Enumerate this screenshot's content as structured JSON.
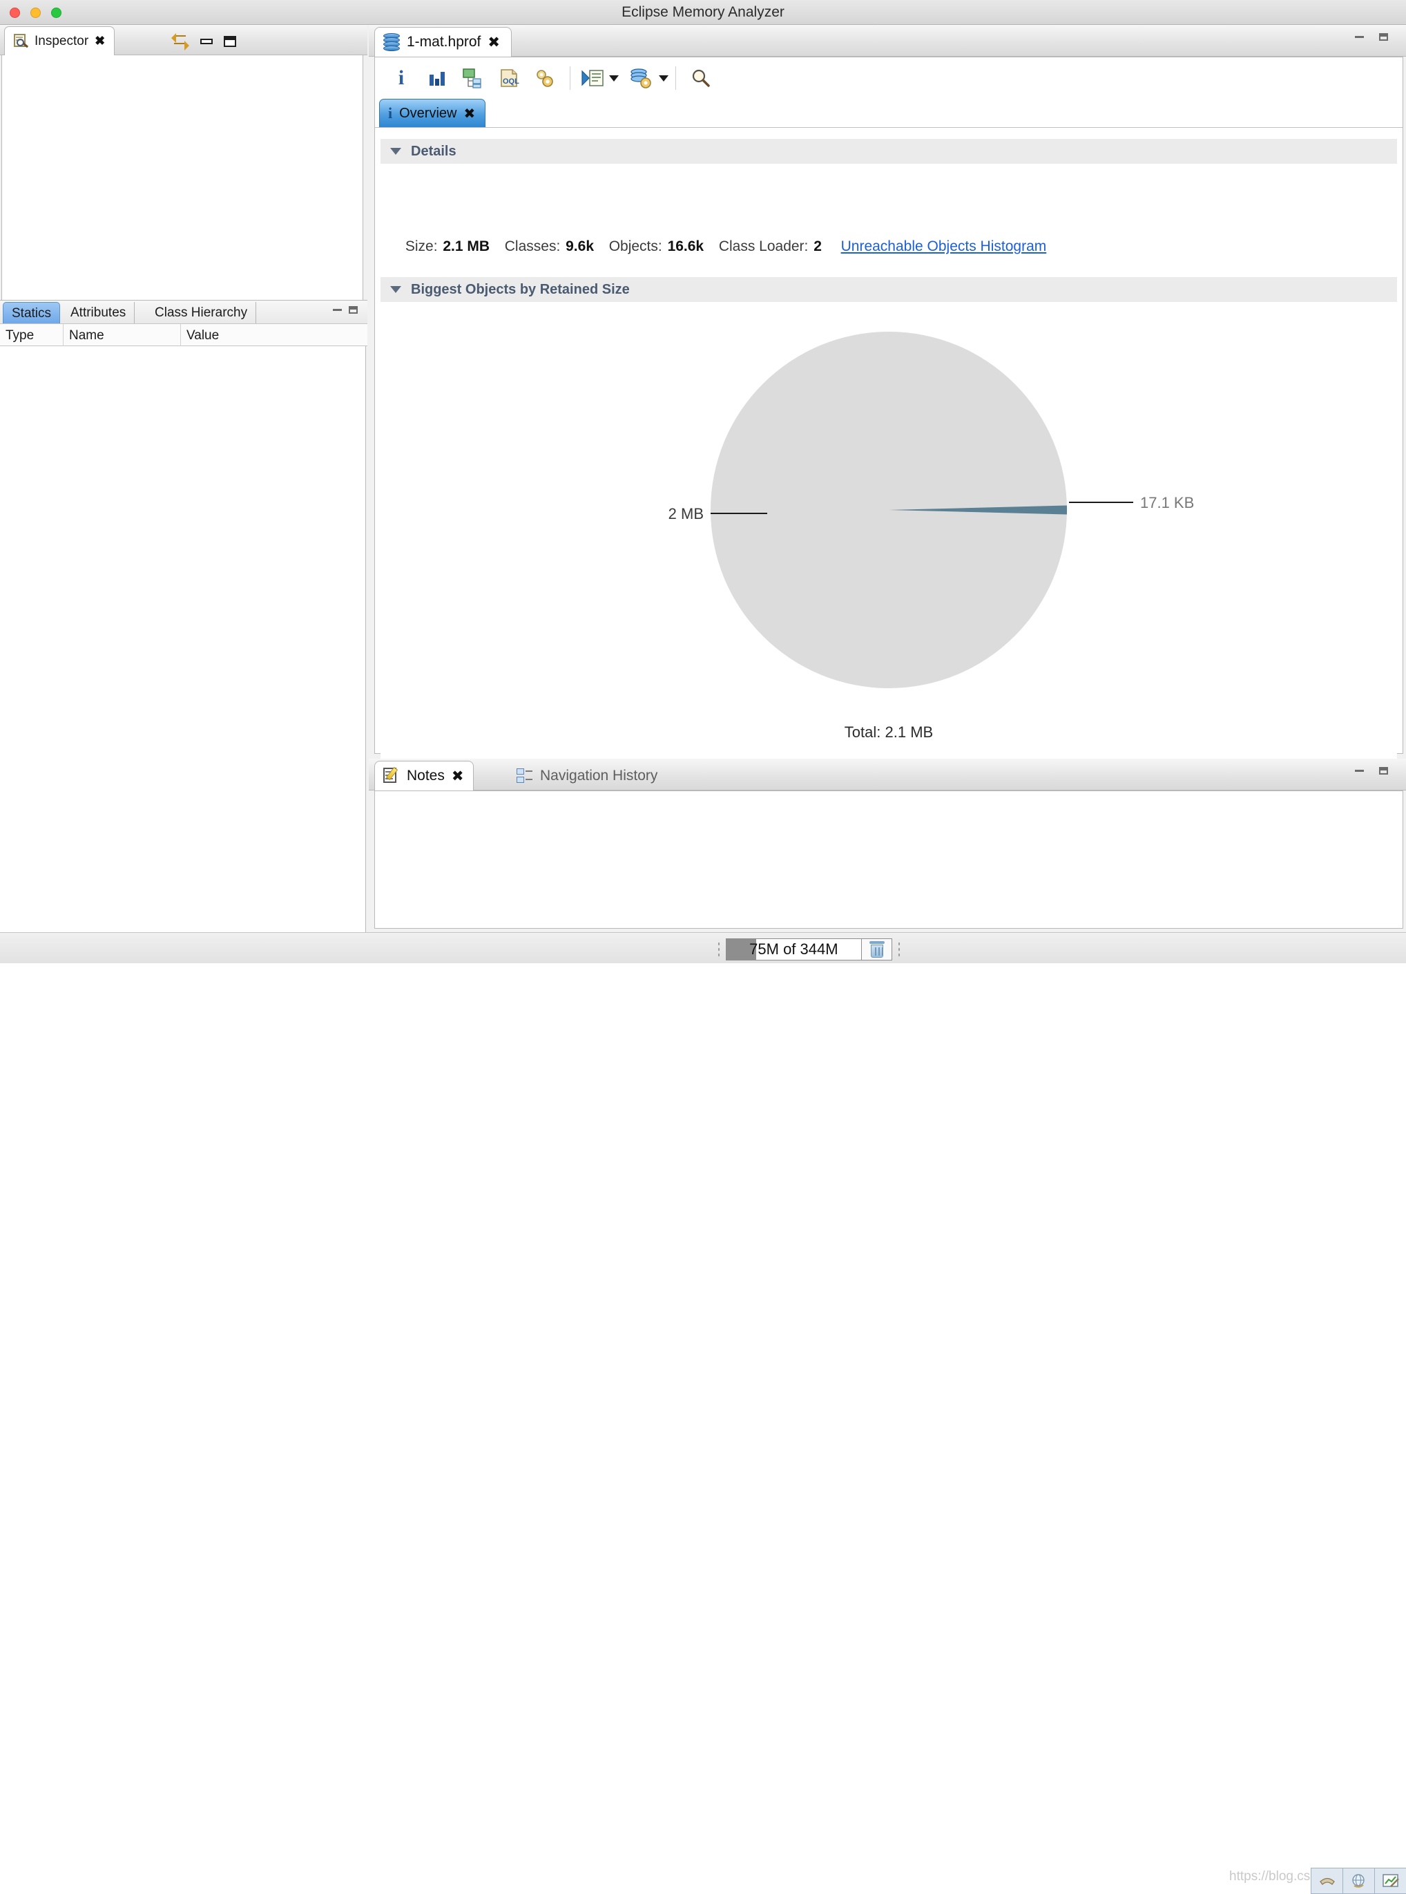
{
  "window": {
    "title": "Eclipse Memory Analyzer",
    "traffic_lights": [
      "close",
      "minimize",
      "maximize"
    ]
  },
  "inspector": {
    "tab_label": "Inspector",
    "tab_icon": "inspector-icon",
    "toolbar": {
      "link_with_editor": "link-with-editor-icon",
      "minimize": "minimize-icon",
      "maximize": "maximize-icon"
    },
    "subtabs": [
      {
        "label": "Statics",
        "selected": true
      },
      {
        "label": "Attributes",
        "selected": false
      },
      {
        "label": "Class Hierarchy",
        "selected": false
      }
    ],
    "columns": [
      "Type",
      "Name",
      "Value"
    ],
    "rows": []
  },
  "editor": {
    "tab_label": "1-mat.hprof",
    "tab_icon": "heap-dump-icon",
    "toolbar_buttons": [
      {
        "name": "overview-icon",
        "label": "i"
      },
      {
        "name": "histogram-icon",
        "label": "Histogram"
      },
      {
        "name": "dominator-tree-icon",
        "label": "Dominator Tree"
      },
      {
        "name": "oql-icon",
        "label": "OQL"
      },
      {
        "name": "leak-suspects-icon",
        "label": "Leak Suspects"
      },
      {
        "name": "run-expert-system-icon",
        "label": "Run Expert System Test",
        "has_menu": true
      },
      {
        "name": "query-browser-icon",
        "label": "Query Browser",
        "has_menu": true
      },
      {
        "name": "find-icon",
        "label": "Find"
      }
    ],
    "result_tabs": [
      {
        "label": "Overview",
        "icon": "info-icon",
        "selected": true
      }
    ],
    "sections": {
      "details": {
        "title": "Details",
        "expanded": true,
        "fields": [
          {
            "label": "Size:",
            "value": "2.1 MB"
          },
          {
            "label": "Classes:",
            "value": "9.6k"
          },
          {
            "label": "Objects:",
            "value": "16.6k"
          },
          {
            "label": "Class Loader:",
            "value": "2"
          }
        ],
        "link": "Unreachable Objects Histogram"
      },
      "biggest_objects": {
        "title": "Biggest Objects by Retained Size",
        "expanded": true
      }
    }
  },
  "chart_data": {
    "type": "pie",
    "title": "Biggest Objects by Retained Size",
    "total_label": "Total: 2.1 MB",
    "legend_position": "callout-labels",
    "slices": [
      {
        "label": "2 MB",
        "value": 2097152,
        "percent": 99.2,
        "color": "#dcdcdc",
        "callout_side": "left"
      },
      {
        "label": "17.1 KB",
        "value": 17510,
        "percent": 0.8,
        "color": "#5b7f93",
        "callout_side": "right"
      }
    ]
  },
  "bottom_panel": {
    "tabs": [
      {
        "label": "Notes",
        "icon": "notes-icon",
        "selected": true
      },
      {
        "label": "Navigation History",
        "icon": "navigation-history-icon",
        "selected": false
      }
    ],
    "notes_content": ""
  },
  "status_bar": {
    "heap_text": "75M of 344M",
    "heap_used_percent": 22,
    "trash_icon": "trash-icon",
    "watermark": "https://blog.csdn.net/wild_onlyk",
    "tray_icons": [
      "phone-icon",
      "globe-icon",
      "chart-pen-icon"
    ]
  },
  "colors": {
    "accent_blue": "#2f86d0",
    "link_blue": "#1b5fd9",
    "section_header_text": "#4a5a70",
    "pie_major": "#dcdcdc",
    "pie_minor": "#5b7f93"
  }
}
